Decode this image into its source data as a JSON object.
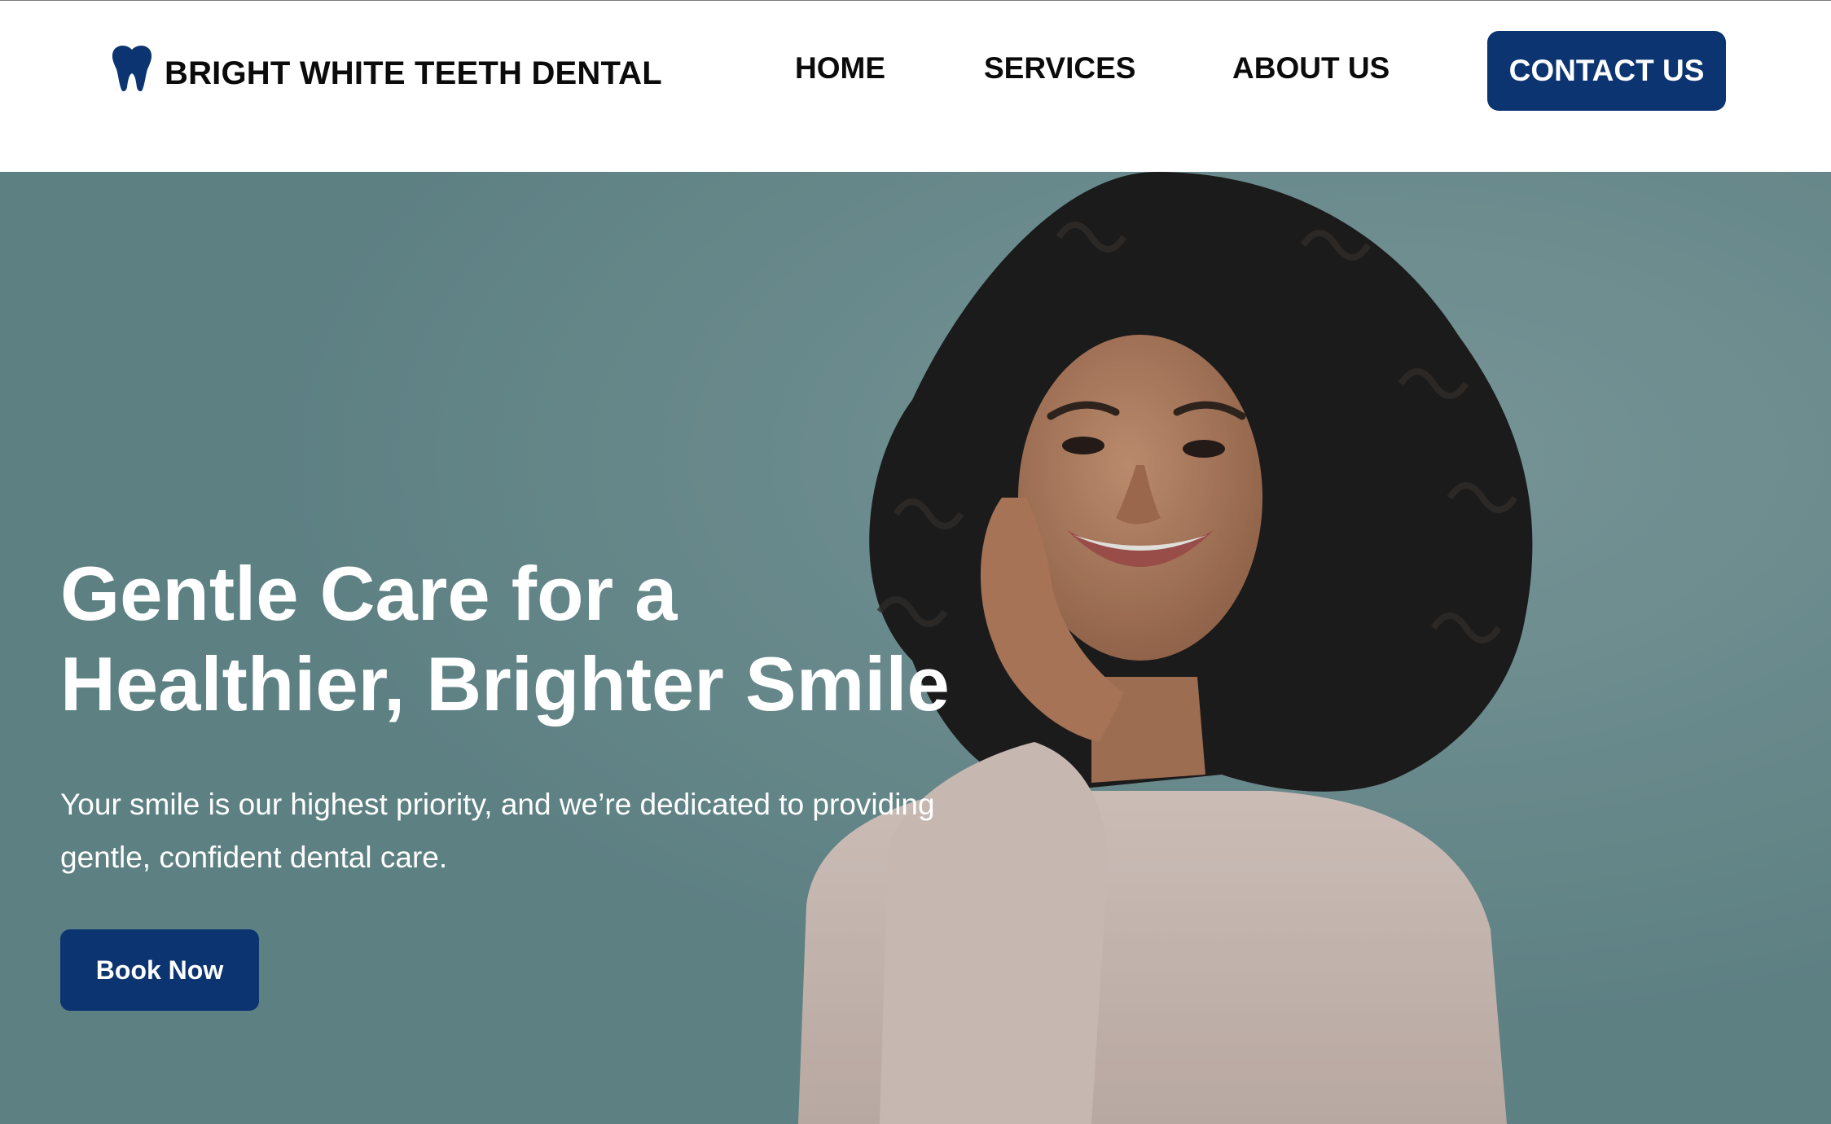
{
  "brand": {
    "name": "BRIGHT WHITE TEETH DENTAL",
    "icon": "tooth-icon",
    "color": "#0b3471"
  },
  "nav": {
    "items": [
      {
        "label": "HOME"
      },
      {
        "label": "SERVICES"
      },
      {
        "label": "ABOUT US"
      }
    ],
    "contact_label": "CONTACT US"
  },
  "hero": {
    "title_line1": "Gentle Care for a",
    "title_line2": "Healthier, Brighter Smile",
    "subtitle_line1": "Your smile is our highest priority, and we’re dedicated to providing",
    "subtitle_line2": "gentle, confident dental care.",
    "cta_label": "Book Now",
    "image": "smiling-woman-photo"
  },
  "colors": {
    "accent": "#0b3471",
    "hero_background": "#6c8d8f",
    "header_background": "#ffffff",
    "text_on_hero": "#ffffff"
  }
}
